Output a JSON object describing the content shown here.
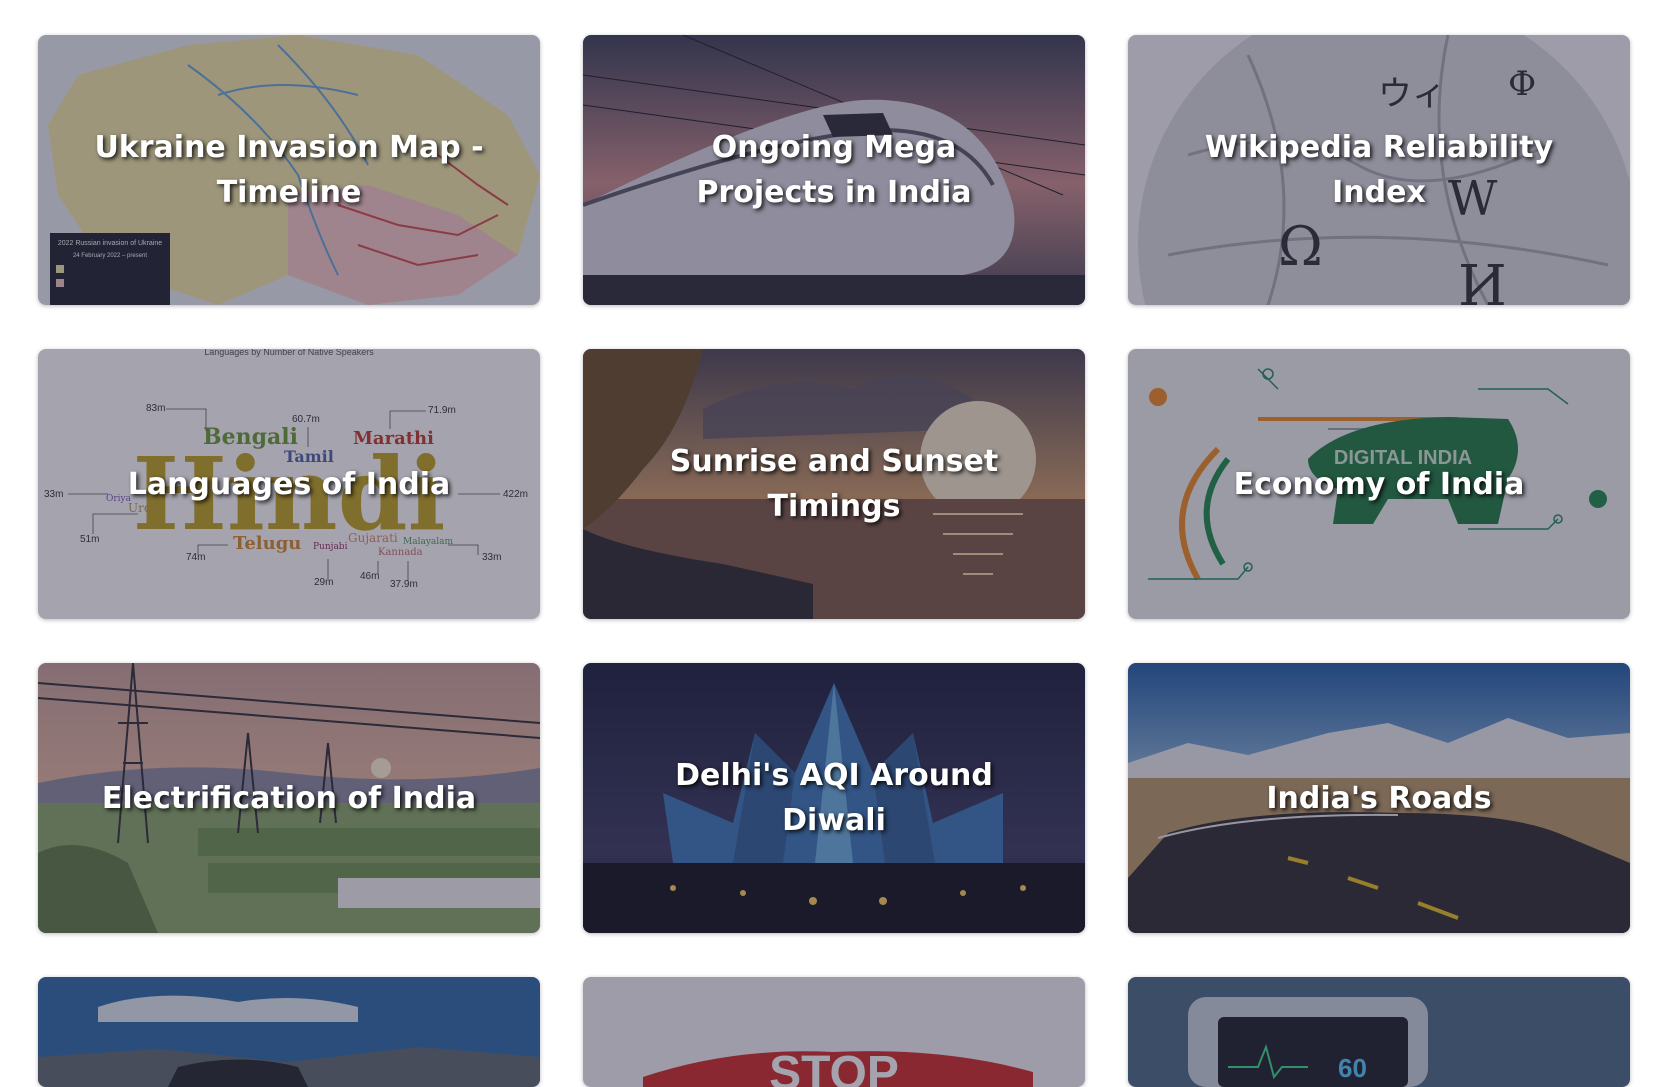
{
  "cards": [
    {
      "title": "Ukraine Invasion Map - Timeline",
      "thumb_icon": "ukraine-map-image"
    },
    {
      "title": "Ongoing Mega Projects in India",
      "thumb_icon": "bullet-train-image"
    },
    {
      "title": "Wikipedia Reliability Index",
      "thumb_icon": "wikipedia-globe-image"
    },
    {
      "title": "Languages of India",
      "thumb_icon": "language-wordcloud-image"
    },
    {
      "title": "Sunrise and Sunset Timings",
      "thumb_icon": "sunset-sea-image"
    },
    {
      "title": "Economy of India",
      "thumb_icon": "digital-india-lion-image"
    },
    {
      "title": "Electrification of India",
      "thumb_icon": "power-lines-image"
    },
    {
      "title": "Delhi's AQI Around Diwali",
      "thumb_icon": "lotus-temple-image"
    },
    {
      "title": "India's Roads",
      "thumb_icon": "mountain-road-image"
    },
    {
      "title": "",
      "thumb_icon": "landscape-car-image"
    },
    {
      "title": "",
      "thumb_icon": "stop-sign-image"
    },
    {
      "title": "",
      "thumb_icon": "heart-monitor-image"
    }
  ],
  "thumb_text": {
    "ukraine_legend_title": "2022 Russian invasion of Ukraine",
    "ukraine_legend_date": "24 February 2022 – present",
    "languages_chart_title": "Languages by Number of Native Speakers",
    "languages_words": [
      "Hindi",
      "Bengali",
      "Marathi",
      "Tamil",
      "Urdu",
      "Telugu",
      "Gujarati",
      "Kannada",
      "Malayalam",
      "Punjabi",
      "Oriya"
    ],
    "languages_values": [
      "83m",
      "60.7m",
      "71.9m",
      "33m",
      "422m",
      "51m",
      "74m",
      "29m",
      "46m",
      "37.9m",
      "33m"
    ],
    "digital_india_label": "DIGITAL INDIA",
    "stop_label": "STOP",
    "monitor_value": "60"
  },
  "colors": {
    "overlay": "#28263e",
    "title_text": "#ffffff",
    "page_bg": "#ffffff"
  }
}
